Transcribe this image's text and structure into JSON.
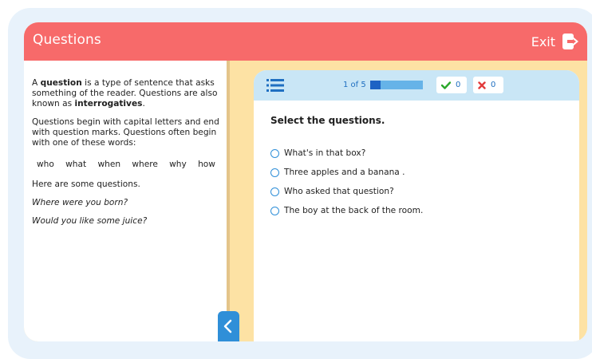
{
  "header": {
    "title": "Questions",
    "exit_label": "Exit"
  },
  "colors": {
    "header": "#f76a6a",
    "accent": "#2f8fd8",
    "panel_bg": "#fde2a4",
    "quiz_bar": "#c9e6f6"
  },
  "reading": {
    "p1_a": "A ",
    "p1_b": "question",
    "p1_c": " is a type of sentence that asks something of the reader. Questions are also known as ",
    "p1_d": "interrogatives",
    "p1_e": ".",
    "p2": "Questions begin with capital letters and end with question marks. Questions often begin with one of these words:",
    "words": [
      "who",
      "what",
      "when",
      "where",
      "why",
      "how"
    ],
    "p3": "Here are some questions.",
    "example1": "Where were you born?",
    "example2": "Would you like some juice?"
  },
  "quiz": {
    "progress_text": "1 of 5",
    "progress_fraction": 0.2,
    "correct_count": "0",
    "wrong_count": "0",
    "prompt": "Select the questions.",
    "options": [
      "What's in that box?",
      "Three apples and a banana .",
      "Who asked that question?",
      "The boy at the back of the room."
    ]
  },
  "icons": {
    "exit": "exit-door-icon",
    "menu": "hamburger-menu-icon",
    "collapse": "chevron-left-icon",
    "correct": "checkmark-icon",
    "wrong": "x-mark-icon"
  }
}
